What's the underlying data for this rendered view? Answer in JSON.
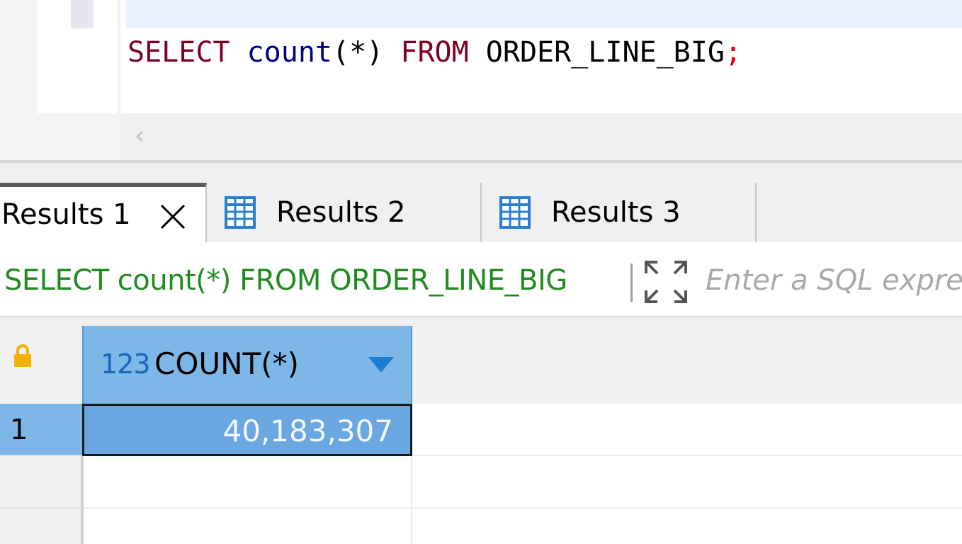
{
  "editor": {
    "code": {
      "kw_select": "SELECT",
      "fn_count": "count",
      "args": "(*)",
      "kw_from": "FROM",
      "table": "ORDER_LINE_BIG",
      "terminator": ";"
    },
    "scroll_left_icon": "‹"
  },
  "tabs": [
    {
      "label": "Results 1",
      "active": true,
      "icon": "close-icon"
    },
    {
      "label": "Results 2",
      "active": false,
      "icon": "grid-icon"
    },
    {
      "label": "Results 3",
      "active": false,
      "icon": "grid-icon"
    }
  ],
  "filter": {
    "current_query": "SELECT count(*) FROM ORDER_LINE_BIG",
    "placeholder": "Enter a SQL expression to filter results (use Ctrl+Space)"
  },
  "grid": {
    "columns": [
      {
        "type_badge": "123",
        "name": "COUNT(*)"
      }
    ],
    "rows": [
      {
        "num": "1",
        "values": [
          "40,183,307"
        ]
      }
    ]
  },
  "colors": {
    "header_blue": "#7db7e8",
    "selected_cell": "#6aa6e0",
    "keyword": "#7f0022",
    "function": "#000080",
    "filter_text": "#1e8c1e",
    "grid_icon": "#2a7fd4",
    "lock_icon": "#f2b000"
  }
}
